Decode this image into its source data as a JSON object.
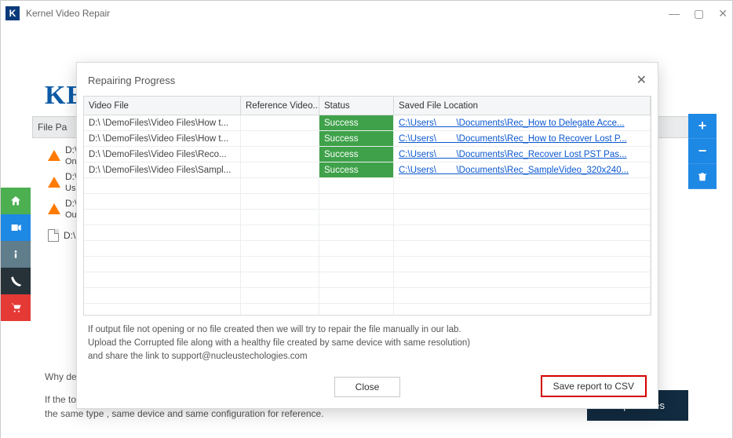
{
  "window": {
    "title": "Kernel Video Repair"
  },
  "brand": "KE",
  "bg_header": "File Pa",
  "bg_files": [
    {
      "label": "D:\\",
      "sub": "On"
    },
    {
      "label": "D:\\",
      "sub": "Us"
    },
    {
      "label": "D:\\",
      "sub": "Ou"
    },
    {
      "label": "D:\\",
      "sub": ""
    }
  ],
  "bottom": {
    "why": "Why de",
    "tip": "If the tool is not able to identify the basic video structure, you need to add a healthy video file of the same type , same device and same configuration for reference.",
    "repair": "Repair Files"
  },
  "modal": {
    "title": "Repairing Progress",
    "columns": {
      "c1": "Video File",
      "c2": "Reference Video...",
      "c3": "Status",
      "c4": "Saved File Location"
    },
    "rows": [
      {
        "file": "D:\\         \\DemoFiles\\Video Files\\How t...",
        "ref": "",
        "status": "Success",
        "loc_pre": "C:\\Users\\",
        "loc_post": "\\Documents\\Rec_How to Delegate Acce..."
      },
      {
        "file": "D:\\         \\DemoFiles\\Video Files\\How t...",
        "ref": "",
        "status": "Success",
        "loc_pre": "C:\\Users\\",
        "loc_post": "\\Documents\\Rec_How to Recover Lost P..."
      },
      {
        "file": "D:\\         \\DemoFiles\\Video Files\\Reco...",
        "ref": "",
        "status": "Success",
        "loc_pre": "C:\\Users\\",
        "loc_post": "\\Documents\\Rec_Recover Lost PST Pas..."
      },
      {
        "file": "D:\\         \\DemoFiles\\Video Files\\Sampl...",
        "ref": "",
        "status": "Success",
        "loc_pre": "C:\\Users\\",
        "loc_post": "\\Documents\\Rec_SampleVideo_320x240..."
      }
    ],
    "note_l1": "If output file not opening or no file created then we will try to repair the file manually in our lab.",
    "note_l2": "Upload the Corrupted file along with a healthy file created by same device with same resolution)",
    "note_l3": " and share the link to support@nucleustechologies.com",
    "close": "Close",
    "csv": "Save report to CSV"
  }
}
